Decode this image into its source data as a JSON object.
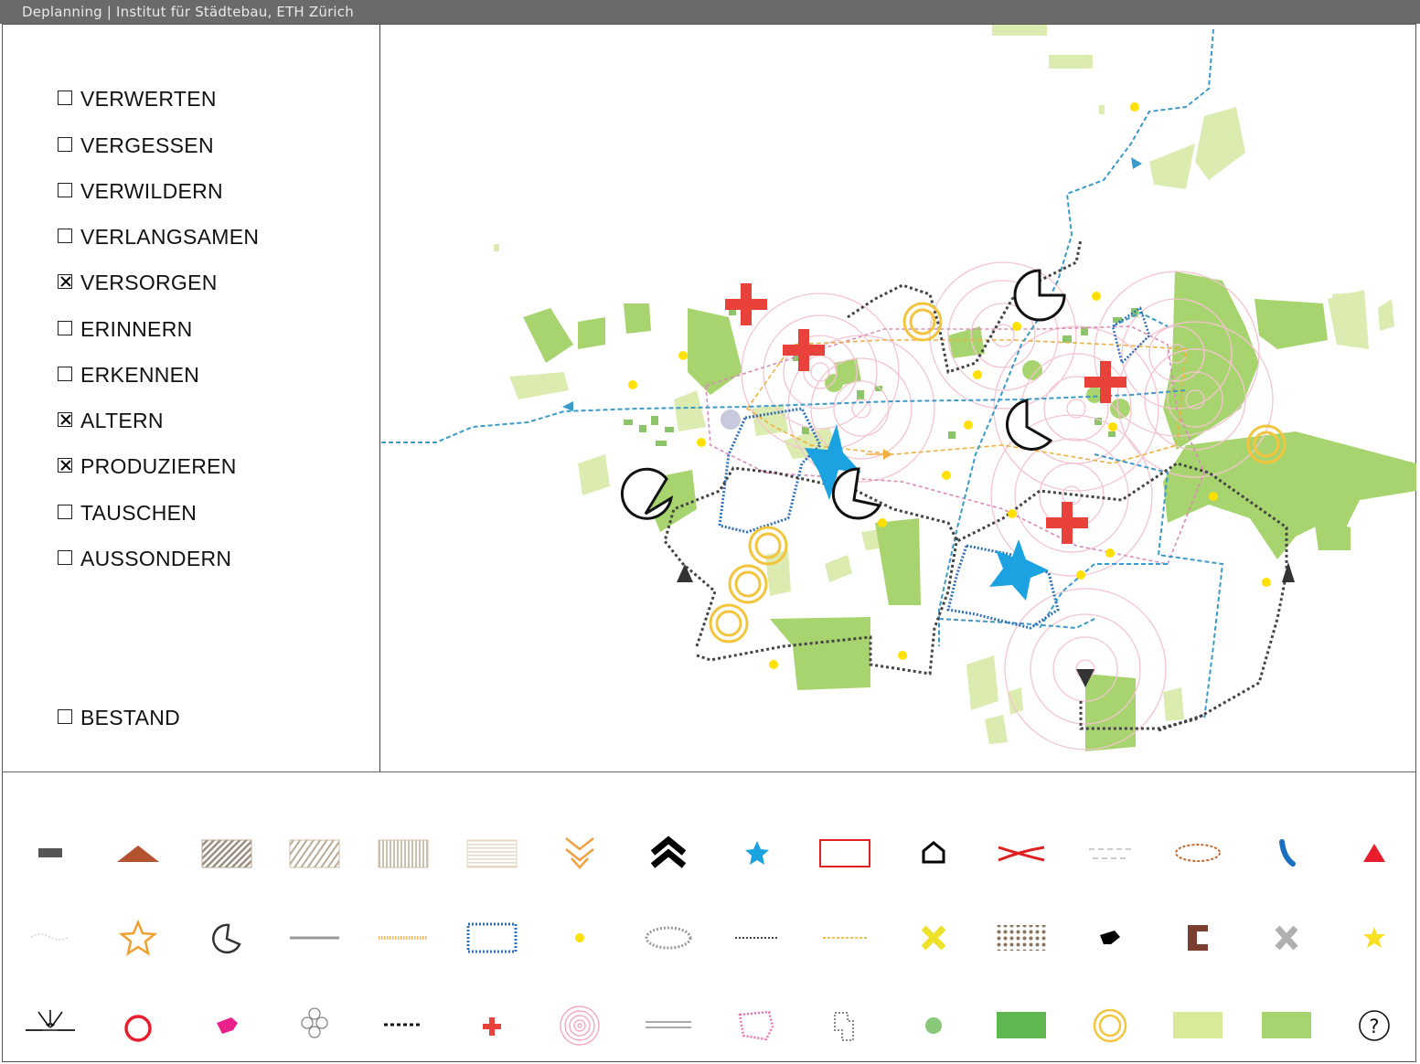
{
  "window": {
    "title": "Deplanning | Institut für Städtebau, ETH Zürich"
  },
  "layers": [
    {
      "id": "verwerten",
      "label": "VERWERTEN",
      "checked": false
    },
    {
      "id": "vergessen",
      "label": "VERGESSEN",
      "checked": false
    },
    {
      "id": "verwildern",
      "label": "VERWILDERN",
      "checked": false
    },
    {
      "id": "verlangsamen",
      "label": "VERLANGSAMEN",
      "checked": false
    },
    {
      "id": "versorgen",
      "label": "VERSORGEN",
      "checked": true
    },
    {
      "id": "erinnern",
      "label": "ERINNERN",
      "checked": false
    },
    {
      "id": "erkennen",
      "label": "ERKENNEN",
      "checked": false
    },
    {
      "id": "altern",
      "label": "ALTERN",
      "checked": true
    },
    {
      "id": "produzieren",
      "label": "PRODUZIEREN",
      "checked": true
    },
    {
      "id": "tauschen",
      "label": "TAUSCHEN",
      "checked": false
    },
    {
      "id": "aussondern",
      "label": "AUSSONDERN",
      "checked": false
    }
  ],
  "bestand": {
    "id": "bestand",
    "label": "BESTAND",
    "checked": false
  },
  "colors": {
    "green": "#a8d46f",
    "light_green": "#dcebb0",
    "red_cross": "#e8423a",
    "blue_path": "#3a9ac9",
    "yellow_dot": "#ffe000",
    "ring_yellow": "#f2c53d",
    "pink_ring": "#f2b8c6",
    "blue_star": "#1aa3e0"
  },
  "legend": {
    "row1": [
      "dash-symbol",
      "roof-symbol",
      "hatched-area-dark",
      "hatched-area-light",
      "vertical-stripes-area",
      "horizontal-stripes-area",
      "double-chevron-down-symbol",
      "double-chevron-up-symbol",
      "blue-star-symbol",
      "red-rectangle-symbol",
      "house-outline-symbol",
      "red-cross-lines-symbol",
      "dashed-gray-lines-symbol",
      "dashed-brown-ellipse-symbol",
      "blue-arc-symbol",
      "red-triangle-symbol"
    ],
    "row2": [
      "wavy-line-symbol",
      "orange-star-outline-symbol",
      "pacman-outline-symbol",
      "gray-line-symbol",
      "orange-dotted-line-symbol",
      "blue-dotted-rectangle-symbol",
      "yellow-dot-symbol",
      "gray-dotted-ellipse-symbol",
      "black-dotted-line-symbol",
      "yellow-dotted-line-symbol",
      "yellow-x-symbol",
      "brown-dot-grid-symbol",
      "black-blob-symbol",
      "brown-bracket-symbol",
      "gray-x-symbol",
      "yellow-star-symbol"
    ],
    "row3": [
      "converging-arrows-symbol",
      "red-circle-outline-symbol",
      "pink-blob-symbol",
      "circle-cluster-symbol",
      "black-dashed-line-symbol",
      "small-red-cross-symbol",
      "pink-concentric-rings-symbol",
      "double-gray-line-symbol",
      "pink-dotted-shape-symbol",
      "gray-dotted-shape-symbol",
      "green-dot-symbol",
      "green-rectangle-symbol",
      "yellow-double-ring-symbol",
      "light-green-rectangle-symbol",
      "medium-green-rectangle-symbol",
      "help-icon"
    ],
    "help_label": "?"
  }
}
